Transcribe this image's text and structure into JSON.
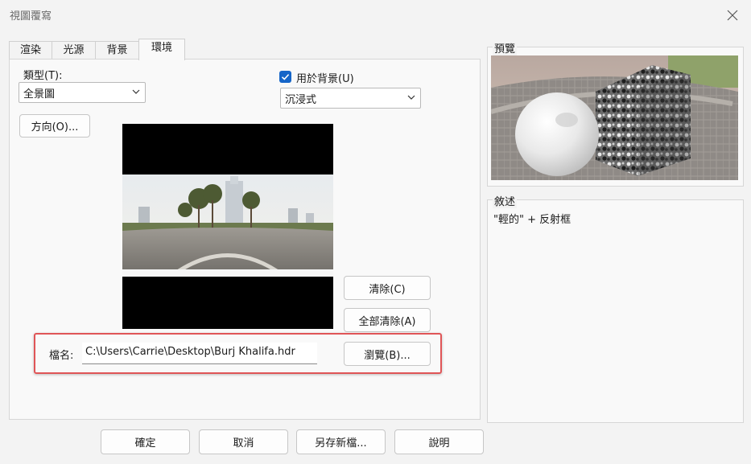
{
  "window": {
    "title": "視圖覆寫"
  },
  "tabs": [
    {
      "label": "渲染",
      "active": false
    },
    {
      "label": "光源",
      "active": false
    },
    {
      "label": "背景",
      "active": false
    },
    {
      "label": "環境",
      "active": true
    }
  ],
  "environment": {
    "type_label": "類型(T):",
    "type_value": "全景圖",
    "use_for_background_label": "用於背景(U)",
    "use_for_background_checked": true,
    "background_mode_value": "沉浸式",
    "direction_button": "方向(O)...",
    "clear_button": "清除(C)",
    "clear_all_button": "全部清除(A)",
    "filename_label": "檔名:",
    "filename_value": "C:\\Users\\Carrie\\Desktop\\Burj Khalifa.hdr",
    "browse_button": "瀏覽(B)..."
  },
  "preview": {
    "title": "預覽"
  },
  "description": {
    "title": "敘述",
    "text": "\"輕的\" + 反射框"
  },
  "footer": {
    "ok_button": "確定",
    "cancel_button": "取消",
    "save_as_button": "另存新檔...",
    "help_button": "說明"
  },
  "colors": {
    "accent": "#1565c8",
    "highlight_frame": "#e05557"
  }
}
